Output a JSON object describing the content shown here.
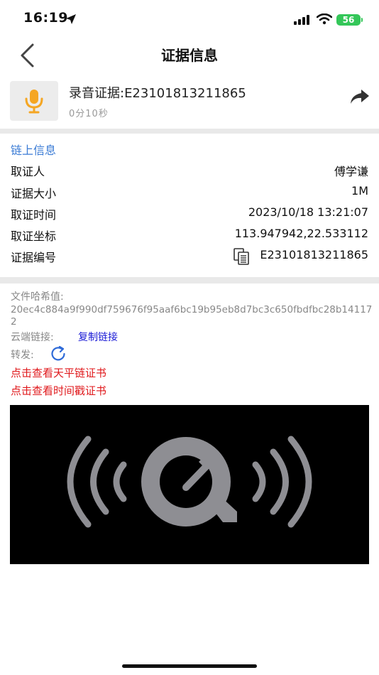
{
  "status_bar": {
    "time": "16:19",
    "battery": "56"
  },
  "nav": {
    "title": "证据信息"
  },
  "evidence": {
    "title": "录音证据:E23101813211865",
    "duration": "0分10秒"
  },
  "chain_info": {
    "section_title": "链上信息",
    "rows": [
      {
        "label": "取证人",
        "value": "傅学谦"
      },
      {
        "label": "证据大小",
        "value": "1M"
      },
      {
        "label": "取证时间",
        "value": "2023/10/18 13:21:07"
      },
      {
        "label": "取证坐标",
        "value": "113.947942,22.533112"
      },
      {
        "label": "证据编号",
        "value": "E23101813211865"
      }
    ]
  },
  "file_info": {
    "hash_label": "文件哈希值:",
    "hash_value": "20ec4c884a9f990df759676f95aaf6bc19b95eb8d7bc3c650fbdfbc28b141172",
    "cloud_label": "云端链接:",
    "cloud_link": "复制链接",
    "forward_label": "转发:",
    "cert_tianping": "点击查看天平链证书",
    "cert_timestamp": "点击查看时间戳证书"
  },
  "colors": {
    "accent_blue": "#3a7bd5",
    "link_blue": "#1a1ad6",
    "link_red": "#e0191c",
    "mic_orange": "#f5a623",
    "battery_green": "#34c759"
  },
  "icons": [
    "location-arrow-icon",
    "signal-icon",
    "wifi-icon",
    "back-chevron-icon",
    "microphone-icon",
    "share-arrow-icon",
    "copy-icon",
    "refresh-icon",
    "quicktime-audio-icon"
  ]
}
